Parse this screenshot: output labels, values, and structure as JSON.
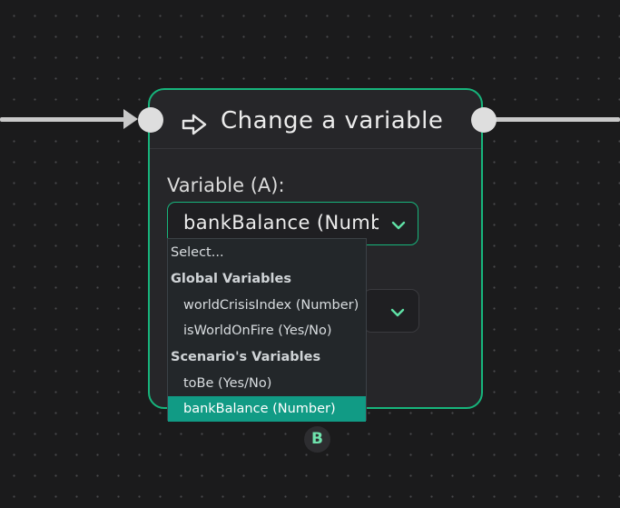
{
  "node": {
    "title": "Change a variable",
    "icon": "arrow-right-icon",
    "accent_color": "#17b57c"
  },
  "variable_field": {
    "label": "Variable (A):",
    "value": "bankBalance (Number)"
  },
  "dropdown": {
    "placeholder": "Select...",
    "groups": [
      {
        "label": "Global Variables",
        "options": [
          "worldCrisisIndex (Number)",
          "isWorldOnFire (Yes/No)"
        ]
      },
      {
        "label": "Scenario's Variables",
        "options": [
          "toBe (Yes/No)",
          "bankBalance (Number)"
        ]
      }
    ],
    "selected": "bankBalance (Number)",
    "selected_color": "#119b85"
  },
  "output_badge": {
    "label": "B"
  }
}
